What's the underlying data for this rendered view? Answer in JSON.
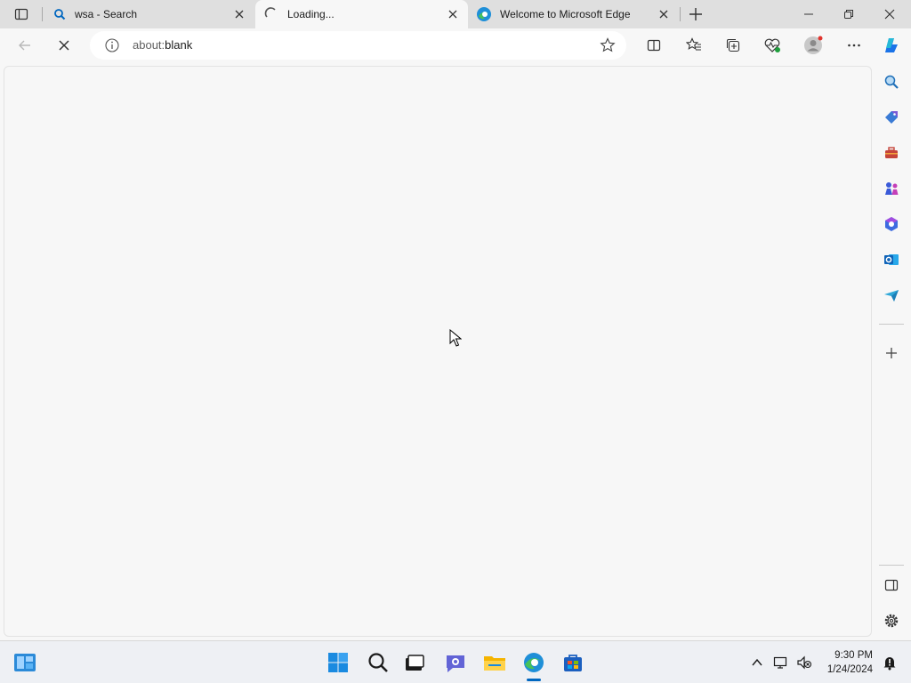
{
  "tabs": [
    {
      "title": "wsa - Search",
      "icon": "search-icon"
    },
    {
      "title": "Loading...",
      "icon": "loading-spinner-icon",
      "active": true
    },
    {
      "title": "Welcome to Microsoft Edge",
      "icon": "edge-icon"
    }
  ],
  "address": {
    "prefix": "about:",
    "host": "blank"
  },
  "clock": {
    "time": "9:30 PM",
    "date": "1/24/2024"
  },
  "colors": {
    "accent": "#0067c0",
    "tab_strip": "#dfdfdf",
    "page": "#f7f7f7"
  }
}
